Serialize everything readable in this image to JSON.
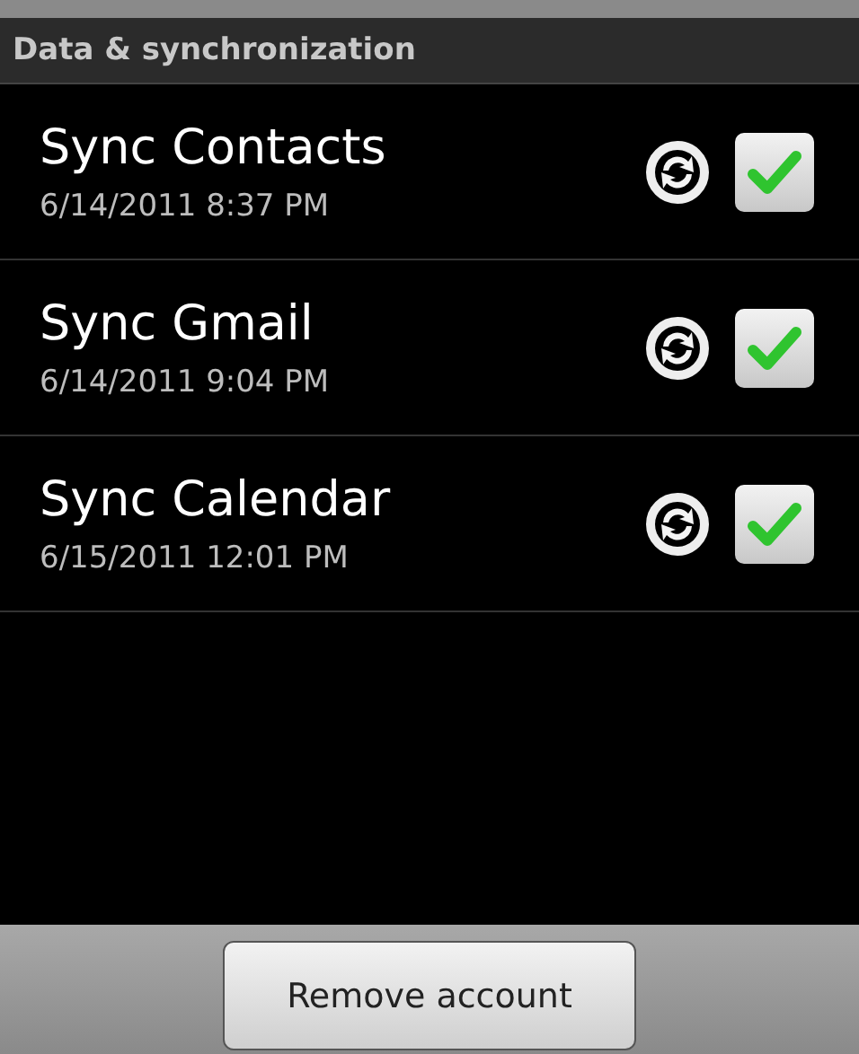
{
  "section_header": "Data & synchronization",
  "sync_items": [
    {
      "title": "Sync Contacts",
      "timestamp": "6/14/2011 8:37 PM",
      "checked": true
    },
    {
      "title": "Sync Gmail",
      "timestamp": "6/14/2011 9:04 PM",
      "checked": true
    },
    {
      "title": "Sync Calendar",
      "timestamp": "6/15/2011 12:01 PM",
      "checked": true
    }
  ],
  "footer_button": "Remove account"
}
